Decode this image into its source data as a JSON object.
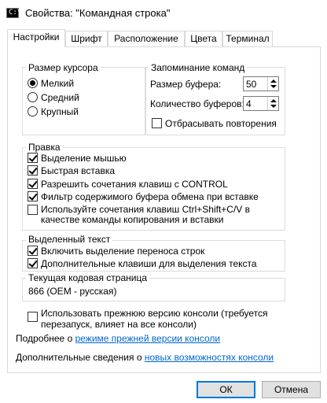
{
  "window": {
    "title": "Свойства: \"Командная строка\"",
    "icon": "console-icon",
    "icon_text": "C:\\"
  },
  "tabs": [
    "Настройки",
    "Шрифт",
    "Расположение",
    "Цвета",
    "Терминал"
  ],
  "cursor_size": {
    "title": "Размер курсора",
    "options": [
      {
        "label": "Мелкий",
        "selected": true
      },
      {
        "label": "Средний",
        "selected": false
      },
      {
        "label": "Крупный",
        "selected": false
      }
    ]
  },
  "command_history": {
    "title": "Запоминание команд",
    "buffer_size_label": "Размер буфера:",
    "buffer_size_value": "50",
    "buffer_count_label": "Количество буферов:",
    "buffer_count_value": "4",
    "discard_duplicates_label": "Отбрасывать повторения",
    "discard_duplicates_checked": false
  },
  "edit": {
    "title": "Правка",
    "options": [
      {
        "label": "Выделение мышью",
        "checked": true
      },
      {
        "label": "Быстрая вставка",
        "checked": true
      },
      {
        "label": "Разрешить сочетания клавиш с CONTROL",
        "checked": true
      },
      {
        "label": "Фильтр содержимого буфера обмена при вставке",
        "checked": true
      },
      {
        "label": "Используйте сочетания клавиш Ctrl+Shift+C/V в",
        "label2": "качестве команды копирования и вставки",
        "checked": false
      }
    ]
  },
  "selection": {
    "title": "Выделенный текст",
    "options": [
      {
        "label": "Включить выделение переноса строк",
        "checked": true
      },
      {
        "label": "Дополнительные клавиши для выделения текста",
        "checked": true
      }
    ]
  },
  "codepage": {
    "title": "Текущая кодовая страница",
    "value": "866   (OEM - русская)"
  },
  "legacy": {
    "label": "Использовать прежнюю версию консоли (требуется",
    "label2": "перезапуск, влияет на все консоли)",
    "checked": false
  },
  "links": {
    "more_prefix": "Подробнее о ",
    "more_link": "режиме прежней версии консоли",
    "info_prefix": "Дополнительные сведения о ",
    "info_link": "новых возможностях консоли"
  },
  "buttons": {
    "ok": "ОК",
    "cancel": "Отмена"
  }
}
